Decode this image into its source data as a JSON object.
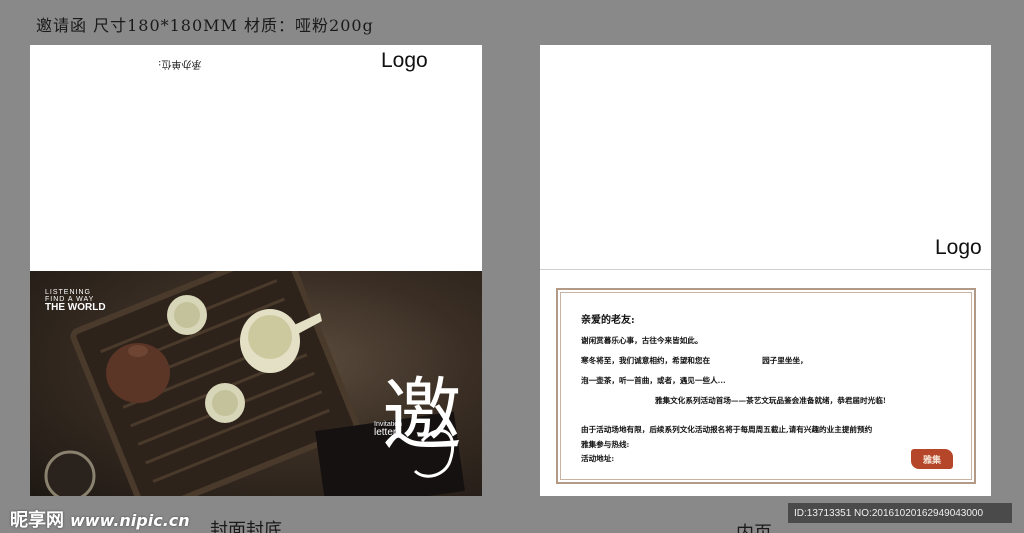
{
  "header": {
    "text": "邀请函 尺寸180*180MM 材质：哑粉200g"
  },
  "cover": {
    "logo": "Logo",
    "flipped_text": "承办单位:",
    "tagline": [
      "LISTENING",
      "FIND A WAY",
      "THE WORLD"
    ],
    "invitation_small": "Invitation",
    "invitation_letter": "letter",
    "calligraphy_char": "邀",
    "caption": "封面封底"
  },
  "inner": {
    "logo": "Logo",
    "caption": "内页",
    "letter": {
      "greeting": "亲爱的老友:",
      "line1": "谢闲赏暮乐心事，古往今来皆如此。",
      "line2a": "寒冬将至，我们诚意相约，希望和您在",
      "line2b": "园子里坐坐，",
      "line3": "泡一壶茶，听一首曲，或者，遇见一些人...",
      "line4": "雅集文化系列活动首场——茶艺文玩品鉴会准备就绪，恭君届时光临!",
      "line5": "由于活动场地有限，后续系列文化活动报名将于每周周五截止,请有兴趣的业主提前预约",
      "line6": "雅集参与热线:",
      "line7": "活动地址:"
    },
    "seal": "雅集"
  },
  "watermark": {
    "brand": "昵享网",
    "url": "www.nipic.cn"
  },
  "id_bar": "ID:13713351 NO:20161020162949043000"
}
